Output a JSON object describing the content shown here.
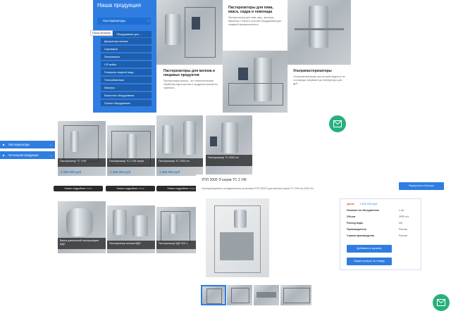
{
  "menu": {
    "heading": "Наша продукция",
    "main_item": "Пастеризаторы",
    "tooltip": "Наша Мозаика",
    "items": [
      "Оборудование для...",
      "Деаэраторы молока",
      "Сыроварни",
      "Ликероварни",
      "CIP мойки",
      "Генератор ледяной воды",
      "Теплообменники",
      "Миксеры",
      "Емкостное оборудование",
      "Прочее оборудование"
    ]
  },
  "cards": {
    "beer": {
      "title": "Пастеризаторы для пива, кваса, сидра и лимонада",
      "desc": "Пастеризаторы для пива, мед - фильтры, версионы с типом и строкою оборудования для пищевой промышленности"
    },
    "milk": {
      "title": "Пастеризаторы для молока и пищевых продуктов",
      "desc": "Пастеризация молока – это технологическая обработка сырья молока и продуктов сроком его хранения..."
    },
    "ultra": {
      "title": "Ультрапастеризаторы",
      "desc": "Ультрапастеризация, при которой жидкость не со секундах нагревают до температуры для дуб..."
    }
  },
  "side_nav": {
    "item1": "Пастеризаторы",
    "item2": "Остальная продукция"
  },
  "products": [
    {
      "label": "Пастеризатор ТС 1УМ",
      "price": "1 080 000 руб",
      "button": "Узнать подробнее >>>>"
    },
    {
      "label": "Пастеризатор ТС 2 УМ серии",
      "price": "1 240 000 руб",
      "button": "Узнать подробнее >>>>"
    },
    {
      "label": "Пастеризатор ТС 1000 л/ч",
      "price": "1 380 000 руб",
      "button": "Узнать подробнее >>>>"
    },
    {
      "label": "Пастеризатор ТС 2000 л/ч",
      "price": "",
      "button": ""
    },
    {
      "label": "Ванна длительной пастеризации ВДП",
      "price": "",
      "button": ""
    },
    {
      "label": "Пастеризатор молока ВДП",
      "price": "",
      "button": ""
    },
    {
      "label": "Пастеризатор ВДП 600 л",
      "price": "",
      "button": ""
    }
  ],
  "detail": {
    "title": "УПЛ 2000 Э серии ТС 2 УМ",
    "subtitle": "Пастеризационно-охладительная установка УПЛ 2000Э для молока серии ТС 2УМ на 2000 л/ч",
    "back_button": "Вернуться к Молоко",
    "price_label": "Цена:",
    "price_value": "1 400 000 руб",
    "specs": [
      {
        "k": "Наличие на объединении",
        "v": "1 шт"
      },
      {
        "k": "Объем",
        "v": "2000 л/ч"
      },
      {
        "k": "Расход воды",
        "v": "нет"
      },
      {
        "k": "Производитель",
        "v": "Россия"
      },
      {
        "k": "Страна производства",
        "v": "Россия"
      }
    ],
    "cart_button": "Добавить в корзину",
    "ask_button": "Задать вопрос по товару"
  },
  "colors": {
    "accent": "#2f7de1",
    "chat": "#27b07d"
  },
  "icons": {
    "chat": "envelope-icon",
    "menu": "folder-icon"
  }
}
